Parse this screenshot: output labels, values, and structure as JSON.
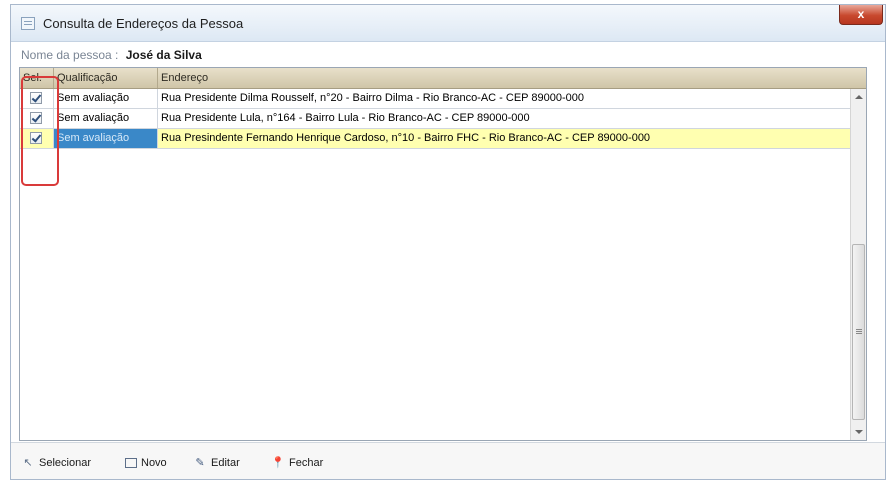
{
  "window": {
    "title": "Consulta de Endereços da Pessoa",
    "close_label": "x"
  },
  "person": {
    "label": "Nome da pessoa :",
    "name": "José da Silva"
  },
  "grid": {
    "headers": {
      "sel": "Sel.",
      "qualificacao": "Qualificação",
      "endereco": "Endereço"
    },
    "filter_icon": "funnel-icon",
    "rows": [
      {
        "checked": true,
        "qualificacao": "Sem avaliação",
        "endereco": "Rua Presidente Dilma Rousself, n°20 - Bairro Dilma - Rio Branco-AC - CEP 89000-000"
      },
      {
        "checked": true,
        "qualificacao": "Sem avaliação",
        "endereco": "Rua Presidente Lula, n°164 - Bairro Lula - Rio Branco-AC - CEP 89000-000"
      },
      {
        "checked": true,
        "qualificacao": "Sem avaliação",
        "endereco": "Rua Presindente Fernando Henrique Cardoso, n°10 - Bairro FHC - Rio Branco-AC - CEP 89000-000"
      }
    ]
  },
  "toolbar": {
    "selecionar": "Selecionar",
    "novo": "Novo",
    "editar": "Editar",
    "fechar": "Fechar"
  },
  "colors": {
    "highlight_row": "#ffffb0",
    "selected_cell": "#3a88c8",
    "annotation_border": "#d93a3a",
    "close_button": "#c8492e"
  }
}
